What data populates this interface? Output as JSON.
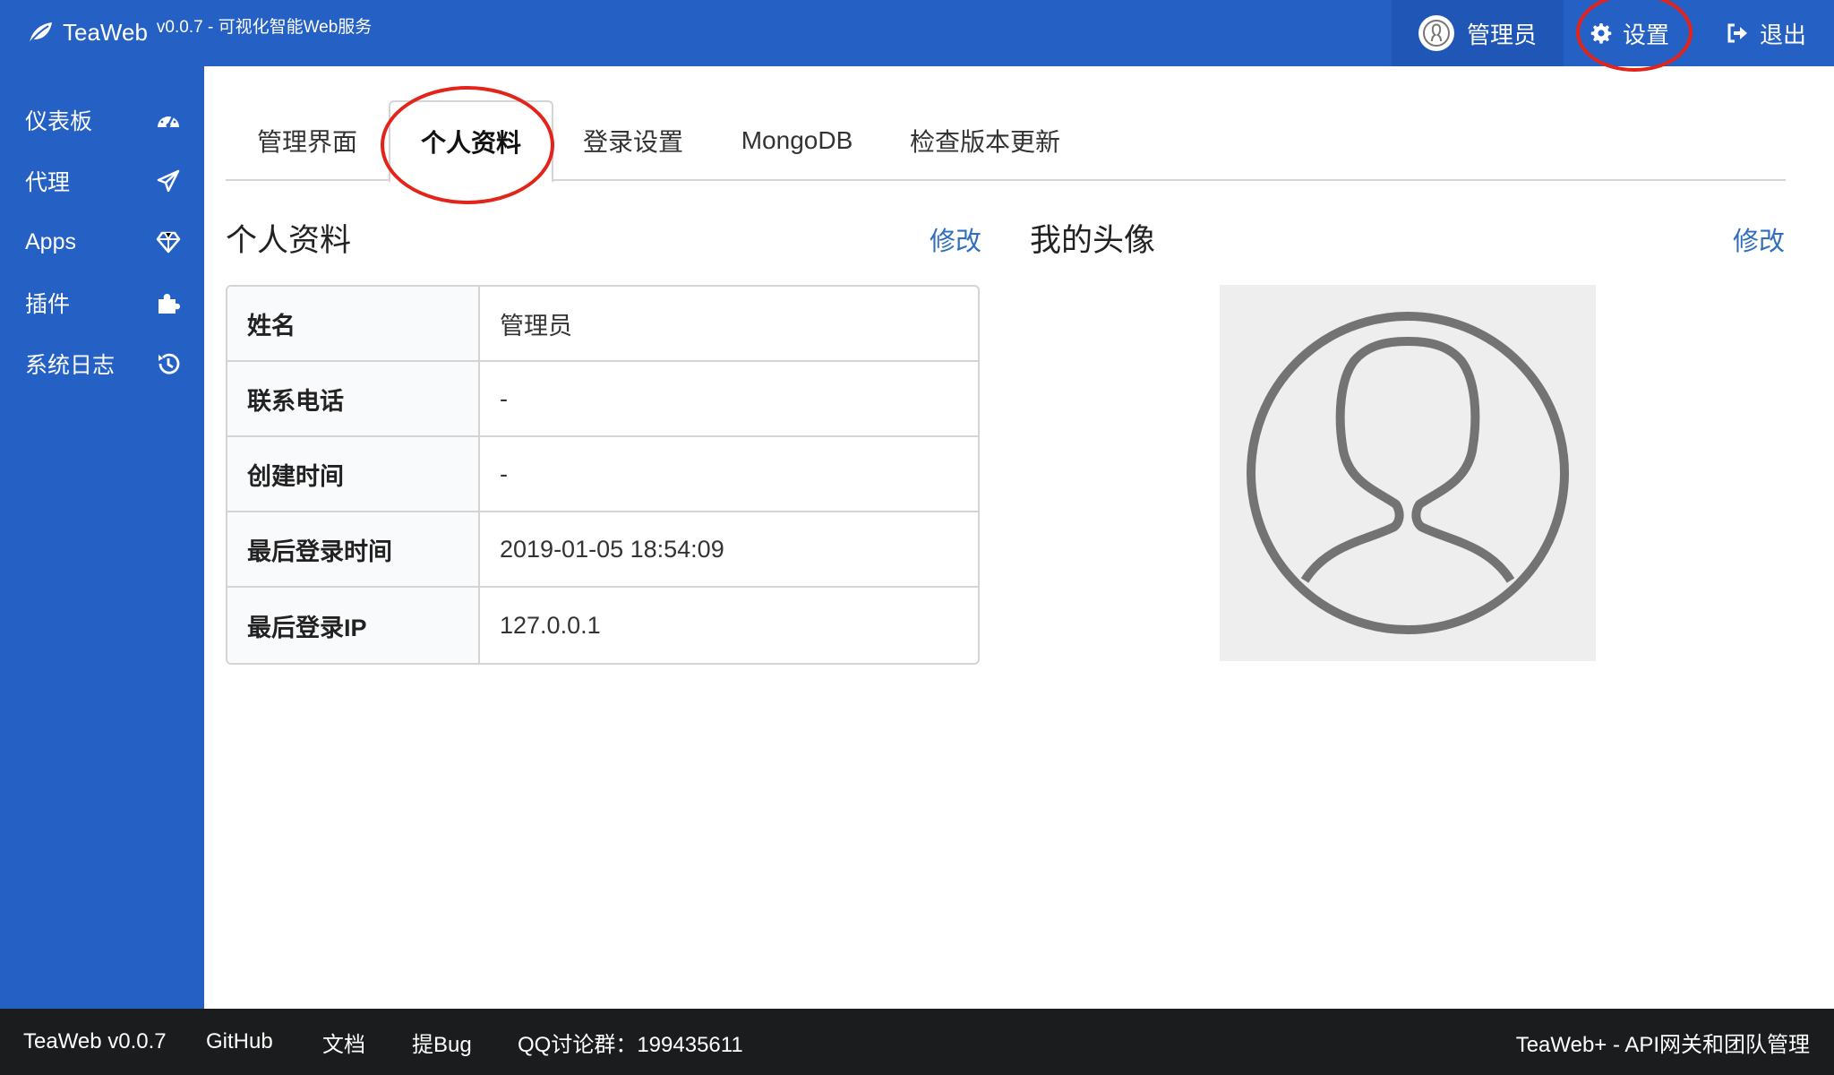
{
  "header": {
    "brand": "TeaWeb",
    "version": "v0.0.7 - 可视化智能Web服务",
    "user_label": "管理员",
    "settings_label": "设置",
    "logout_label": "退出",
    "bar_color": "#2560c4"
  },
  "sidebar": {
    "items": [
      {
        "label": "仪表板",
        "icon": "dashboard-icon"
      },
      {
        "label": "代理",
        "icon": "paper-plane-icon"
      },
      {
        "label": "Apps",
        "icon": "diamond-icon"
      },
      {
        "label": "插件",
        "icon": "puzzle-icon"
      },
      {
        "label": "系统日志",
        "icon": "history-icon"
      }
    ]
  },
  "tabs": [
    {
      "label": "管理界面"
    },
    {
      "label": "个人资料",
      "active": true
    },
    {
      "label": "登录设置"
    },
    {
      "label": "MongoDB"
    },
    {
      "label": "检查版本更新"
    }
  ],
  "profile": {
    "title": "个人资料",
    "edit_label": "修改",
    "rows": [
      {
        "label": "姓名",
        "value": "管理员"
      },
      {
        "label": "联系电话",
        "value": "-"
      },
      {
        "label": "创建时间",
        "value": "-"
      },
      {
        "label": "最后登录时间",
        "value": "2019-01-05 18:54:09"
      },
      {
        "label": "最后登录IP",
        "value": "127.0.0.1"
      }
    ]
  },
  "avatar": {
    "title": "我的头像",
    "edit_label": "修改",
    "icon": "user-circle-icon"
  },
  "footer": {
    "version": "TeaWeb v0.0.7",
    "github": "GitHub",
    "docs": "文档",
    "bug": "提Bug",
    "qq": "QQ讨论群：199435611",
    "promo": "TeaWeb+ - API网关和团队管理"
  },
  "annotations": {
    "circle_color": "#e3241b"
  }
}
